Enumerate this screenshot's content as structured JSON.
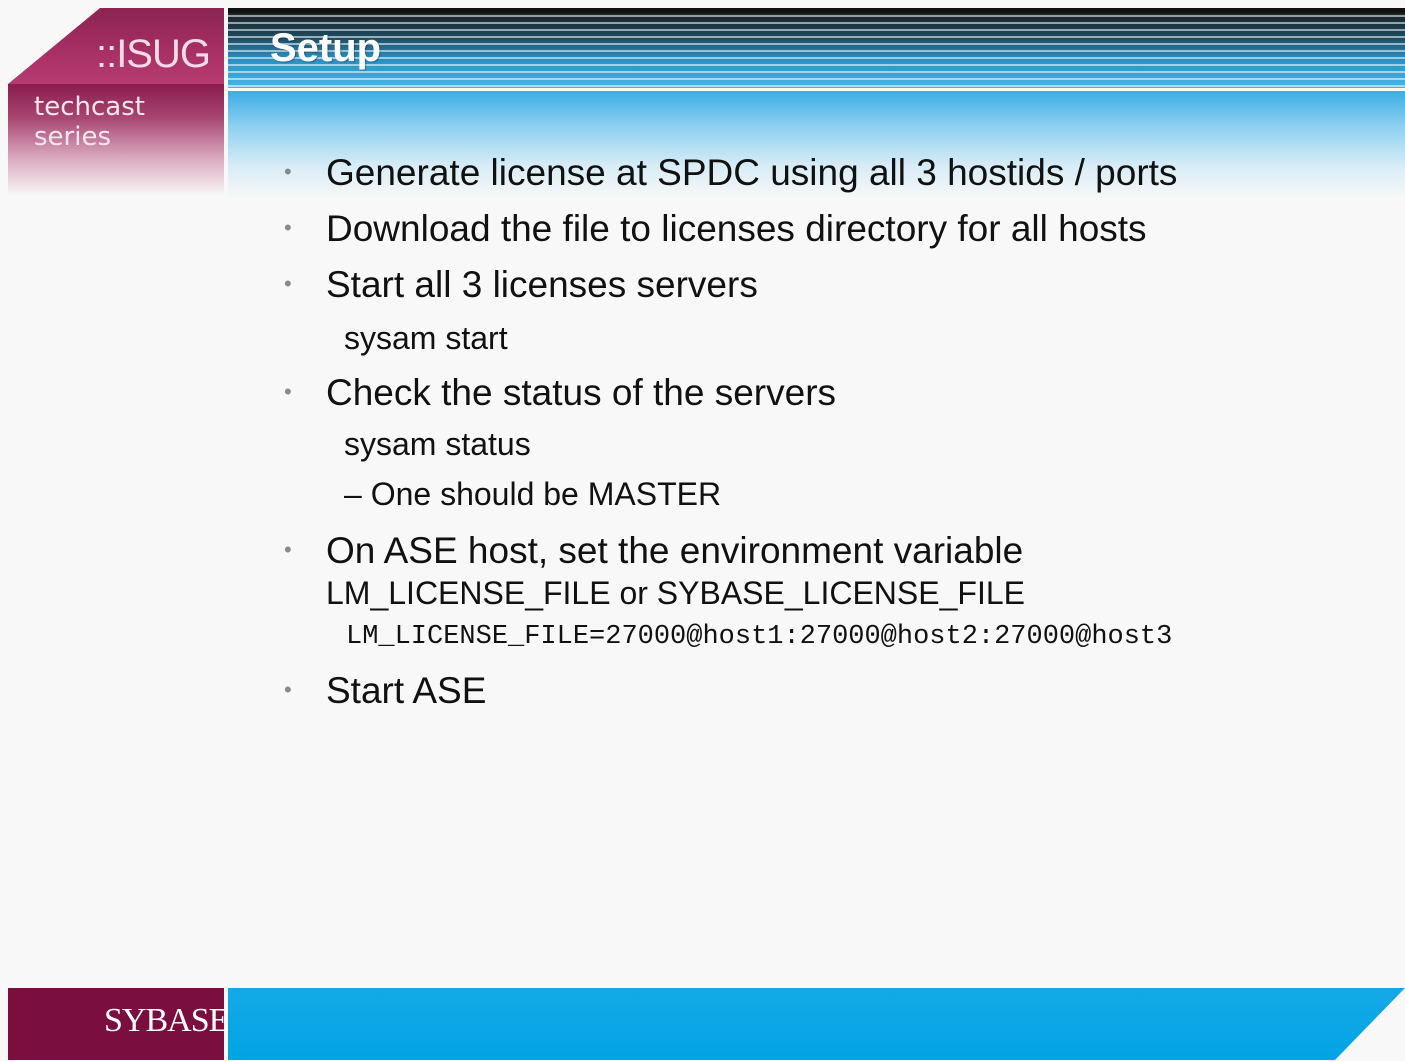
{
  "header": {
    "logo": "::ISUG",
    "series": "techcast series",
    "title": "Setup"
  },
  "content": {
    "items": [
      {
        "kind": "bullet",
        "text": "Generate license at SPDC using all 3 hostids / ports"
      },
      {
        "kind": "bullet",
        "text": "Download the file to licenses directory for all hosts"
      },
      {
        "kind": "bullet",
        "text": "Start all 3 licenses servers"
      },
      {
        "kind": "indent",
        "text": "sysam start"
      },
      {
        "kind": "bullet",
        "text": "Check the status of the servers"
      },
      {
        "kind": "indent",
        "text": "sysam status"
      },
      {
        "kind": "dash",
        "text": "– One should be MASTER"
      },
      {
        "kind": "bullet",
        "text": "On ASE host, set the environment variable"
      },
      {
        "kind": "cont",
        "text": "LM_LICENSE_FILE or SYBASE_LICENSE_FILE"
      },
      {
        "kind": "code",
        "text": "LM_LICENSE_FILE=27000@host1:27000@host2:27000@host3"
      },
      {
        "kind": "bullet",
        "text": "Start ASE"
      }
    ],
    "bullet_glyph": "•"
  },
  "footer": {
    "brand": "SYBASE"
  },
  "colors": {
    "brand_maroon": "#7a0e3f",
    "brand_blue": "#02a4e4"
  }
}
